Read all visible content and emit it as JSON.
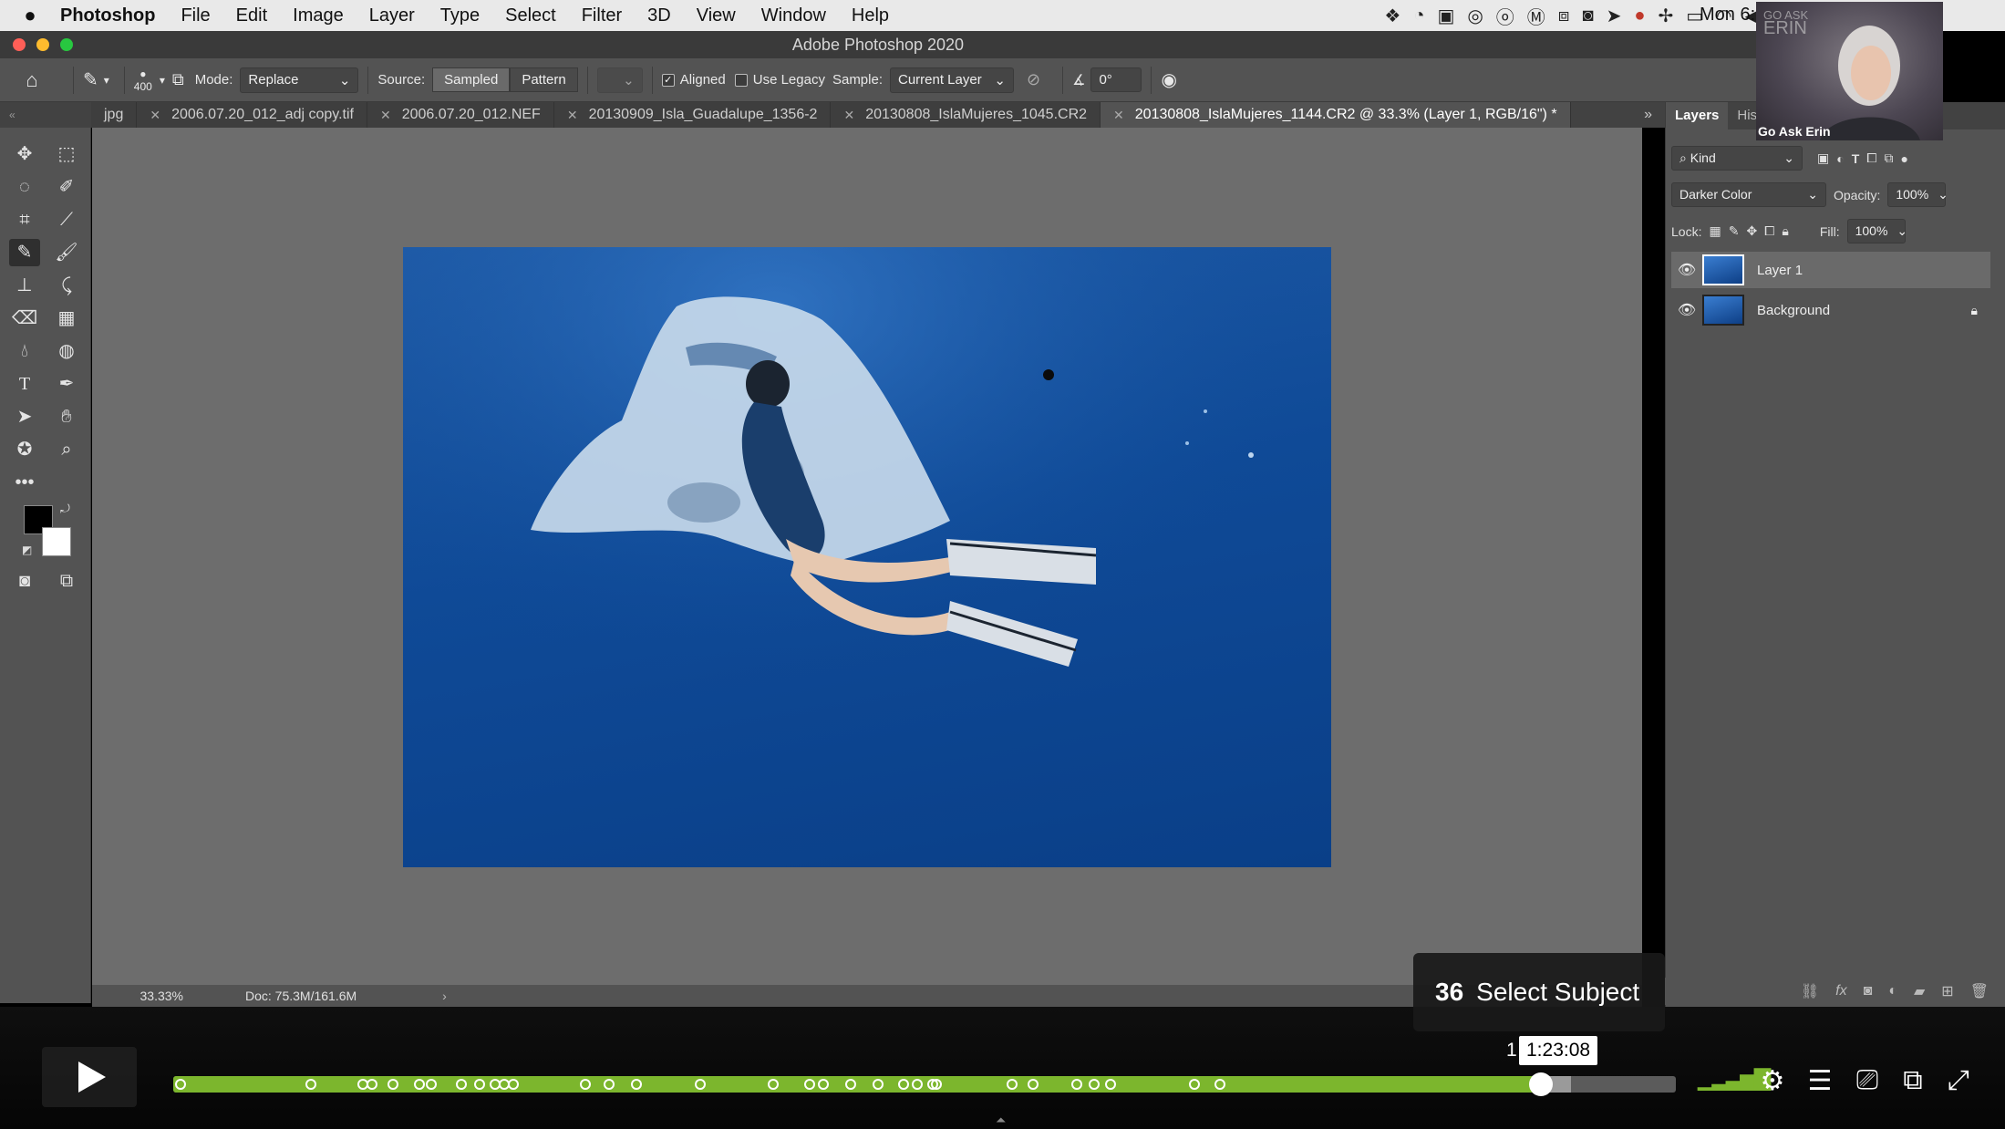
{
  "menubar": {
    "items": [
      "Photoshop",
      "File",
      "Edit",
      "Image",
      "Layer",
      "Type",
      "Select",
      "Filter",
      "3D",
      "View",
      "Window",
      "Help"
    ],
    "clock": "Mon 6:"
  },
  "window": {
    "title": "Adobe Photoshop 2020"
  },
  "options": {
    "brush_size": "400",
    "mode_label": "Mode:",
    "mode_value": "Replace",
    "source_label": "Source:",
    "source_sampled": "Sampled",
    "source_pattern": "Pattern",
    "aligned_label": "Aligned",
    "use_legacy_label": "Use Legacy",
    "sample_label": "Sample:",
    "sample_value": "Current Layer",
    "angle_value": "0°"
  },
  "tabs": [
    {
      "label": "jpg"
    },
    {
      "label": "2006.07.20_012_adj copy.tif"
    },
    {
      "label": "2006.07.20_012.NEF"
    },
    {
      "label": "20130909_Isla_Guadalupe_1356-2"
    },
    {
      "label": "20130808_IslaMujeres_1045.CR2"
    },
    {
      "label": "20130808_IslaMujeres_1144.CR2 @ 33.3% (Layer 1, RGB/16\") *"
    }
  ],
  "status": {
    "zoom": "33.33%",
    "doc": "Doc: 75.3M/161.6M"
  },
  "panel": {
    "tab_layers": "Layers",
    "tab_history": "His",
    "filter_kind": "Kind",
    "blend_mode": "Darker Color",
    "opacity_label": "Opacity:",
    "opacity_value": "100%",
    "lock_label": "Lock:",
    "fill_label": "Fill:",
    "fill_value": "100%",
    "layers": [
      {
        "name": "Layer 1"
      },
      {
        "name": "Background"
      }
    ]
  },
  "webcam": {
    "caption": "Go Ask Erin",
    "brand_line1": "GO ASK",
    "brand_line2": "ERIN"
  },
  "player": {
    "chapter_number": "36",
    "chapter_title": "Select Subject",
    "time": "1:23:08",
    "time_prefix": "1",
    "progress_fraction": 0.91,
    "buffered_fraction": 0.93,
    "colors": {
      "played": "#7cb62d",
      "track": "#5b5b5b"
    }
  },
  "icons": [
    "apple-icon",
    "home-icon",
    "healing-brush-icon",
    "move-icon",
    "marquee-icon",
    "lasso-icon",
    "quick-select-icon",
    "crop-icon",
    "eyedropper-icon",
    "brush-icon",
    "stamp-icon",
    "history-brush-icon",
    "eraser-icon",
    "gradient-icon",
    "blur-icon",
    "dodge-icon",
    "type-icon",
    "pen-icon",
    "path-select-icon",
    "hand-icon",
    "shape-icon",
    "zoom-icon",
    "eye-icon",
    "lock-icon",
    "gear-icon",
    "fullscreen-icon"
  ]
}
